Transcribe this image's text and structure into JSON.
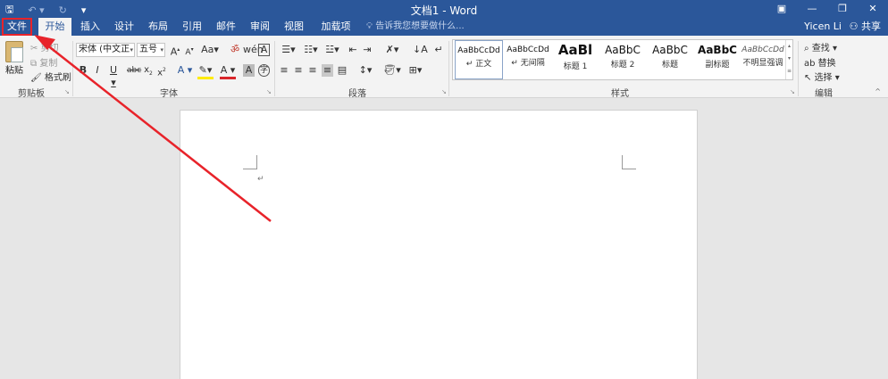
{
  "app": {
    "title": "文档1 - Word",
    "user": "Yicen Li",
    "share_label": "共享",
    "tell_me_placeholder": "告诉我您想要做什么..."
  },
  "tabs": [
    {
      "label": "文件"
    },
    {
      "label": "开始"
    },
    {
      "label": "插入"
    },
    {
      "label": "设计"
    },
    {
      "label": "布局"
    },
    {
      "label": "引用"
    },
    {
      "label": "邮件"
    },
    {
      "label": "审阅"
    },
    {
      "label": "视图"
    },
    {
      "label": "加载项"
    }
  ],
  "clipboard": {
    "group_label": "剪贴板",
    "paste_label": "粘贴",
    "cut_label": "剪切",
    "copy_label": "复制",
    "format_painter_label": "格式刷"
  },
  "font": {
    "group_label": "字体",
    "font_name": "宋体 (中文正",
    "font_size": "五号",
    "change_case": "Aa"
  },
  "paragraph": {
    "group_label": "段落"
  },
  "styles": {
    "group_label": "样式",
    "items": [
      {
        "sample": "AaBbCcDd",
        "name": "↵ 正文"
      },
      {
        "sample": "AaBbCcDd",
        "name": "↵ 无间隔"
      },
      {
        "sample": "AaBl",
        "name": "标题 1"
      },
      {
        "sample": "AaBbC",
        "name": "标题 2"
      },
      {
        "sample": "AaBbC",
        "name": "标题"
      },
      {
        "sample": "AaBbC",
        "name": "副标题"
      },
      {
        "sample": "AaBbCcDd",
        "name": "不明显强调"
      }
    ]
  },
  "editing": {
    "group_label": "编辑",
    "find_label": "查找",
    "replace_label": "替换",
    "select_label": "选择"
  },
  "colors": {
    "ribbon_blue": "#2b579a",
    "annotation_red": "#e8232a"
  }
}
